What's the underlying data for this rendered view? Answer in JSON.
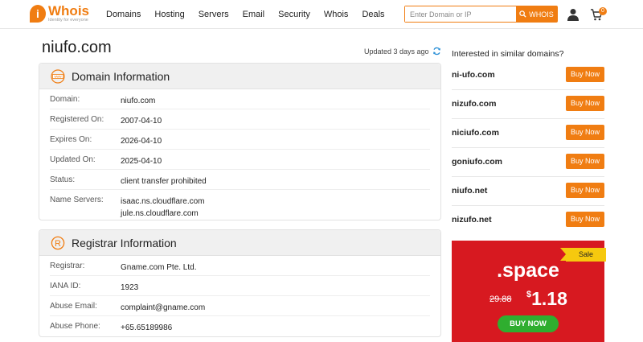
{
  "header": {
    "logo_text": "Whois",
    "logo_tagline": "Identity for everyone",
    "nav": [
      "Domains",
      "Hosting",
      "Servers",
      "Email",
      "Security",
      "Whois",
      "Deals"
    ],
    "search_placeholder": "Enter Domain or IP",
    "search_button": "WHOIS",
    "cart_count": "0"
  },
  "main": {
    "domain": "niufo.com",
    "updated": "Updated 3 days ago",
    "domain_info": {
      "title": "Domain Information",
      "rows": [
        {
          "label": "Domain:",
          "value": "niufo.com"
        },
        {
          "label": "Registered On:",
          "value": "2007-04-10"
        },
        {
          "label": "Expires On:",
          "value": "2026-04-10"
        },
        {
          "label": "Updated On:",
          "value": "2025-04-10"
        },
        {
          "label": "Status:",
          "value": "client transfer prohibited"
        }
      ],
      "name_servers_label": "Name Servers:",
      "name_servers": [
        "isaac.ns.cloudflare.com",
        "jule.ns.cloudflare.com"
      ]
    },
    "registrar_info": {
      "title": "Registrar Information",
      "rows": [
        {
          "label": "Registrar:",
          "value": "Gname.com Pte. Ltd."
        },
        {
          "label": "IANA ID:",
          "value": "1923"
        },
        {
          "label": "Abuse Email:",
          "value": "complaint@gname.com"
        },
        {
          "label": "Abuse Phone:",
          "value": "+65.65189986"
        }
      ]
    }
  },
  "sidebar": {
    "heading": "Interested in similar domains?",
    "buy_label": "Buy Now",
    "suggestions": [
      "ni-ufo.com",
      "nizufo.com",
      "niciufo.com",
      "goniufo.com",
      "niufo.net",
      "nizufo.net"
    ],
    "promo": {
      "badge": "Sale",
      "tld": ".space",
      "old_price": "29.88",
      "currency": "$",
      "new_price": "1.18",
      "button": "BUY NOW"
    }
  }
}
